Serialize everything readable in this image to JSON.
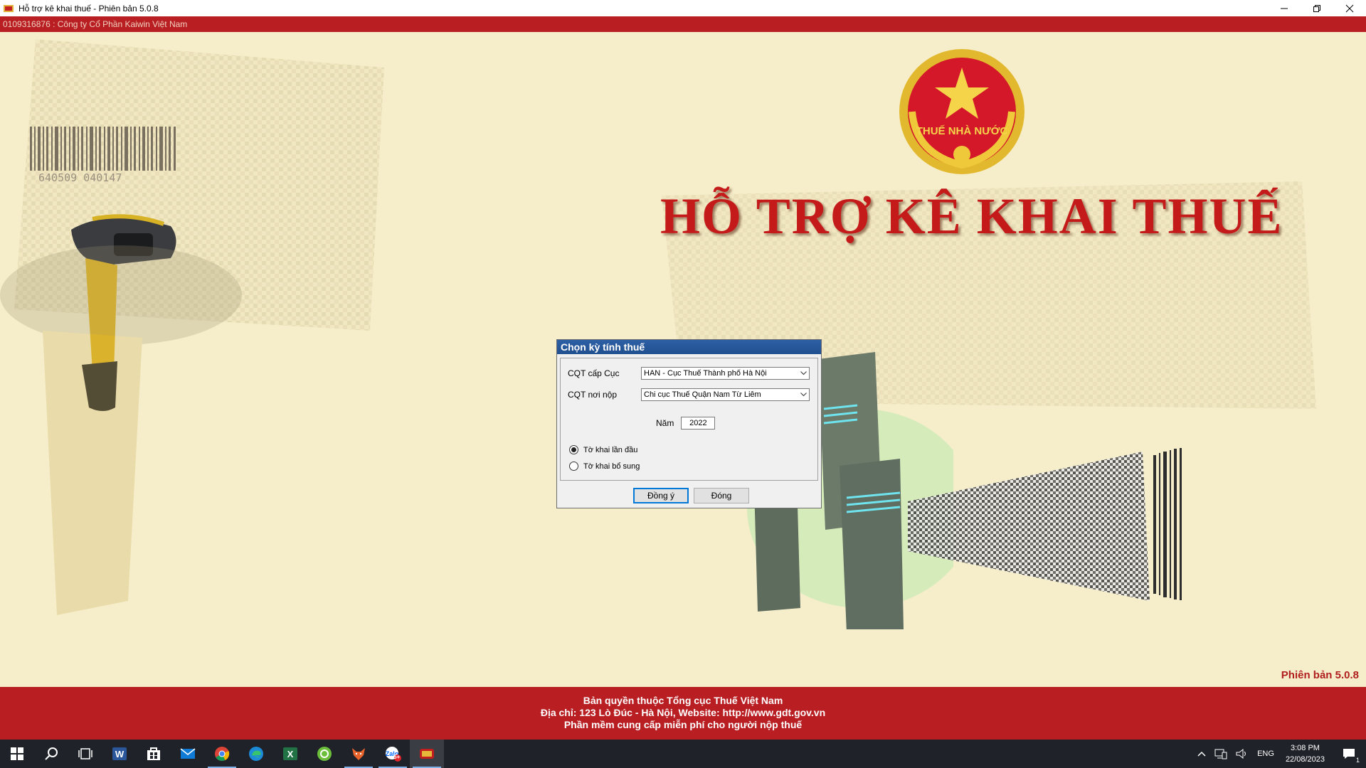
{
  "window": {
    "title": "Hỗ trợ kê khai thuế -  Phiên bản 5.0.8",
    "company": "0109316876 : Công ty Cổ Phần Kaiwin Việt Nam"
  },
  "banner": {
    "headline": "HỖ TRỢ KÊ KHAI THUẾ",
    "emblem_text": "THUẾ NHÀ NƯỚC",
    "barcode_digits": "640509  040147",
    "version": "Phiên bản 5.0.8"
  },
  "dialog": {
    "title": "Chọn kỳ tính thuế",
    "cqt_cap_cuc_label": "CQT cấp Cục",
    "cqt_cap_cuc_value": "HAN - Cục Thuế Thành phố Hà Nội",
    "cqt_noi_nop_label": "CQT nơi nộp",
    "cqt_noi_nop_value": "Chi cục Thuế Quận Nam Từ Liêm",
    "nam_label": "Năm",
    "nam_value": "2022",
    "radio_first_label": "Tờ khai lần đầu",
    "radio_supplement_label": "Tờ khai bổ sung",
    "selected_radio": "first",
    "ok_label": "Đồng ý",
    "close_label": "Đóng"
  },
  "footer": {
    "line1": "Bản quyền thuộc Tổng cục Thuế Việt Nam",
    "line2": "Địa chỉ: 123 Lò Đúc - Hà Nội, Website: http://www.gdt.gov.vn",
    "line3": "Phần mềm cung cấp miễn phí cho người nộp thuế"
  },
  "taskbar": {
    "language": "ENG",
    "time": "3:08 PM",
    "date": "22/08/2023",
    "notification_count": "1",
    "zalo_badge": "5+"
  },
  "colors": {
    "brand_red": "#b81e22",
    "background": "#f6eecb",
    "dialog_title": "#2d5fa6"
  }
}
